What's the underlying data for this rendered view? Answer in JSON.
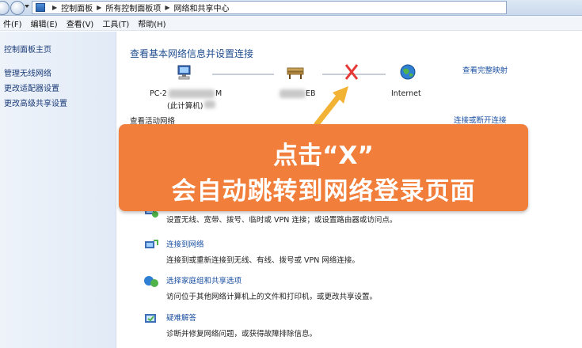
{
  "breadcrumb": [
    "控制面板",
    "所有控制面板项",
    "网络和共享中心"
  ],
  "menu": [
    "件(F)",
    "编辑(E)",
    "查看(V)",
    "工具(T)",
    "帮助(H)"
  ],
  "sidebar": {
    "home": "控制面板主页",
    "links": [
      "管理无线网络",
      "更改适配器设置",
      "更改高级共享设置"
    ]
  },
  "main": {
    "title": "查看基本网络信息并设置连接",
    "view_full_map": "查看完整映射",
    "nodes": {
      "computer_name": "PC-2",
      "computer_name_tail": "M",
      "computer_sub": "(此计算机)",
      "middle_tail": "EB",
      "internet": "Internet"
    },
    "active_networks_label": "查看活动网络",
    "connect_disconnect": "连接或断开连接",
    "tasks": [
      {
        "title": "",
        "desc": "设置无线、宽带、拨号、临时或 VPN 连接；或设置路由器或访问点。"
      },
      {
        "title": "连接到网络",
        "desc": "连接到或重新连接到无线、有线、拨号或 VPN 网络连接。"
      },
      {
        "title": "选择家庭组和共享选项",
        "desc": "访问位于其他网络计算机上的文件和打印机，或更改共享设置。"
      },
      {
        "title": "疑难解答",
        "desc": "诊断并修复网络问题，或获得故障排除信息。"
      }
    ]
  },
  "callout": {
    "line1": "点击“X”",
    "line2": "会自动跳转到网络登录页面"
  },
  "colors": {
    "callout_bg": "#f17f3b",
    "x_mark": "#e53935",
    "arrow": "#f2b233",
    "link": "#1a4fa0"
  }
}
